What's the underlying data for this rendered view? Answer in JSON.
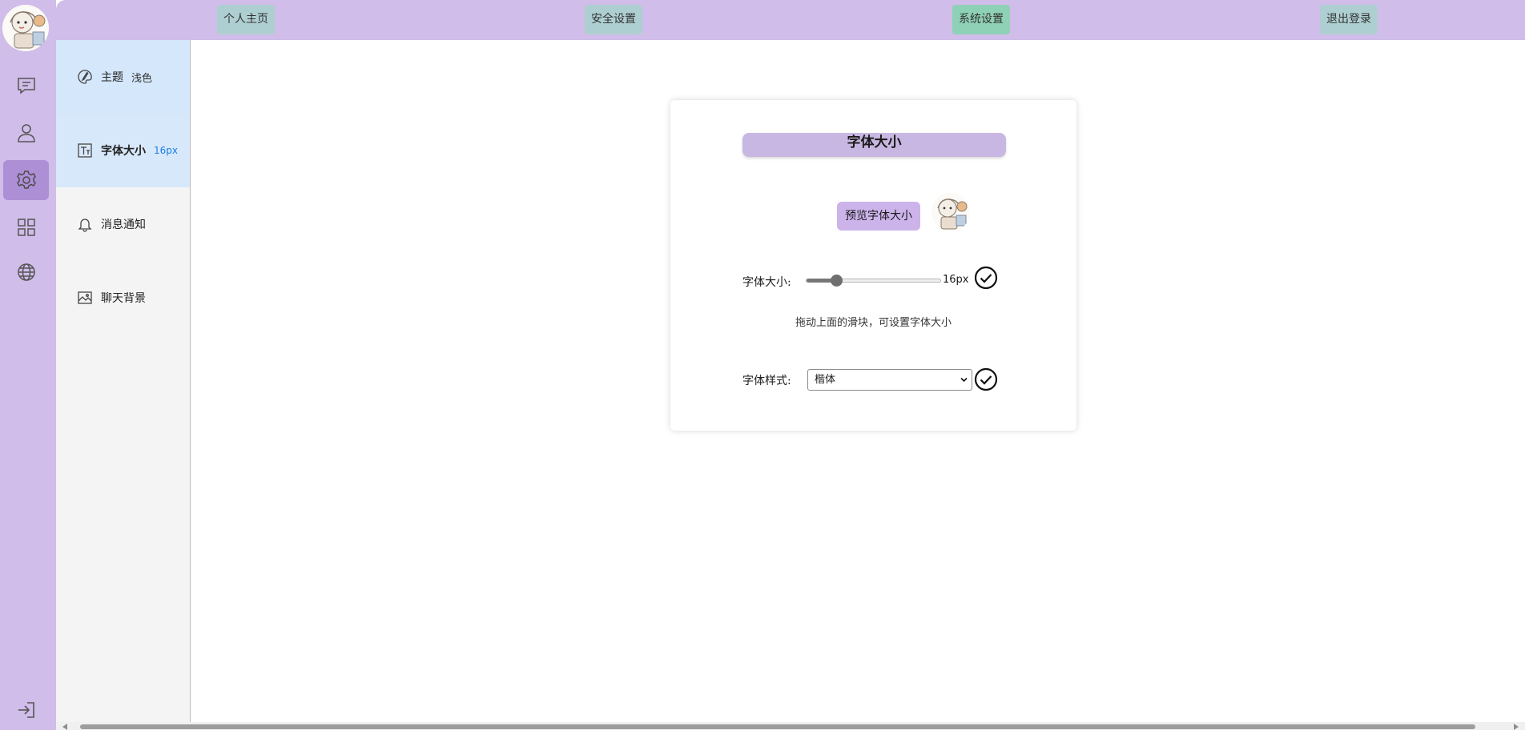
{
  "rail": {
    "items": [
      {
        "icon": "message-icon"
      },
      {
        "icon": "user-icon"
      },
      {
        "icon": "gear-icon",
        "active": true
      },
      {
        "icon": "grid-icon"
      },
      {
        "icon": "globe-icon"
      }
    ],
    "logout_icon": "sign-out-icon"
  },
  "topbar": {
    "items": [
      {
        "label": "个人主页"
      },
      {
        "label": "安全设置"
      },
      {
        "label": "系统设置",
        "active": true
      },
      {
        "label": "退出登录"
      }
    ]
  },
  "sidebar": {
    "items": [
      {
        "label": "主题",
        "value": "浅色",
        "icon": "palette-icon"
      },
      {
        "label": "字体大小",
        "value": "16px",
        "icon": "font-size-icon",
        "active": true
      },
      {
        "label": "消息通知",
        "value": "",
        "icon": "bell-icon"
      },
      {
        "label": "聊天背景",
        "value": "",
        "icon": "image-icon"
      }
    ]
  },
  "card": {
    "title": "字体大小",
    "preview_text": "预览字体大小",
    "size_label": "字体大小:",
    "size_value": "16px",
    "slider_fraction": 0.22,
    "hint": "拖动上面的滑块，可设置字体大小",
    "style_label": "字体样式:",
    "style_value": "楷体"
  },
  "colors": {
    "accent_purple": "#d0bde9",
    "active_top_tab": "#8fd1b7",
    "active_side_value": "#1a7ee8"
  }
}
